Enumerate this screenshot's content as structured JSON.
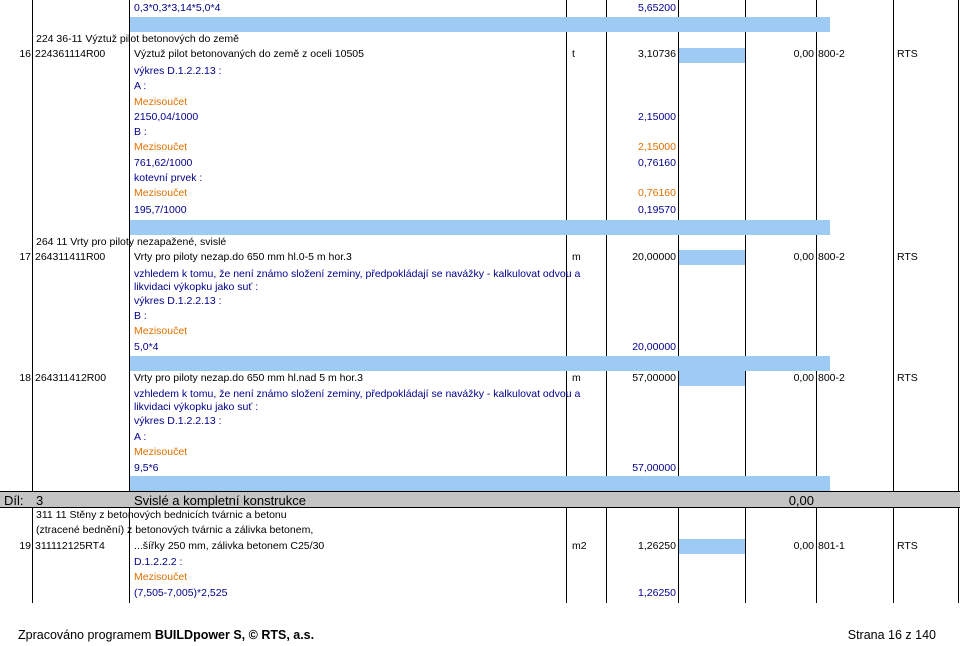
{
  "top_row": {
    "text": "0,3*0,3*3,14*5,0*4",
    "value": "5,65200"
  },
  "group1": {
    "title": "224 36-11 Výztuž pilot betonových do země"
  },
  "item16": {
    "num": "16",
    "code": "224361114R00",
    "desc": "Výztuž pilot betonovaných do země z oceli 10505",
    "unit": "t",
    "qty": "3,10736",
    "price": "0,00",
    "norm": "800-2",
    "src": "RTS",
    "lines": [
      {
        "text": "výkres D.1.2.2.13 :",
        "val": ""
      },
      {
        "text": "A :",
        "val": ""
      },
      {
        "text": "Mezisoučet",
        "val": ""
      },
      {
        "text": "2150,04/1000",
        "val": "2,15000"
      },
      {
        "text": "B :",
        "val": ""
      },
      {
        "text": "Mezisoučet",
        "val": "2,15000"
      },
      {
        "text": "761,62/1000",
        "val": "0,76160"
      },
      {
        "text": "kotevní prvek :",
        "val": ""
      },
      {
        "text": "Mezisoučet",
        "val": "0,76160"
      },
      {
        "text": "195,7/1000",
        "val": "0,19570"
      }
    ]
  },
  "group2": {
    "title": "264 11 Vrty pro piloty nezapažené, svislé"
  },
  "item17": {
    "num": "17",
    "code": "264311411R00",
    "desc": "Vrty pro piloty nezap.do 650 mm hl.0-5 m hor.3",
    "unit": "m",
    "qty": "20,00000",
    "price": "0,00",
    "norm": "800-2",
    "src": "RTS",
    "note1": "vzhledem k tomu, že není známo složení zeminy, předpokládají se navážky - kalkulovat odvou a",
    "note2": "likvidaci výkopku jako suť :",
    "lines": [
      {
        "text": "výkres D.1.2.2.13 :",
        "val": ""
      },
      {
        "text": "B :",
        "val": ""
      },
      {
        "text": "Mezisoučet",
        "val": ""
      },
      {
        "text": "5,0*4",
        "val": "20,00000"
      }
    ]
  },
  "item18": {
    "num": "18",
    "code": "264311412R00",
    "desc": "Vrty pro piloty nezap.do 650 mm hl.nad 5 m hor.3",
    "unit": "m",
    "qty": "57,00000",
    "price": "0,00",
    "norm": "800-2",
    "src": "RTS",
    "note1": "vzhledem k tomu, že není známo složení zeminy, předpokládají se navážky - kalkulovat odvou a",
    "note2": "likvidaci výkopku jako suť :",
    "lines": [
      {
        "text": "výkres D.1.2.2.13 :",
        "val": ""
      },
      {
        "text": "A :",
        "val": ""
      },
      {
        "text": "Mezisoučet",
        "val": ""
      },
      {
        "text": "9,5*6",
        "val": "57,00000"
      }
    ]
  },
  "dil": {
    "label": "Díl:",
    "num": "3",
    "title": "Svislé a kompletní konstrukce",
    "total": "0,00"
  },
  "group3": {
    "title": "311 11 Stěny z betonových bednicích tvárnic a betonu"
  },
  "item19": {
    "pre": "(ztracené bednění) z betonových tvárnic a zálivka betonem,",
    "num": "19",
    "code": "311112125RT4",
    "desc": "...šířky 250 mm, zálivka betonem C25/30",
    "unit": "m2",
    "qty": "1,26250",
    "price": "0,00",
    "norm": "801-1",
    "src": "RTS",
    "lines": [
      {
        "text": "D.1.2.2.2 :",
        "val": ""
      },
      {
        "text": "Mezisoučet",
        "val": ""
      },
      {
        "text": "(7,505-7,005)*2,525",
        "val": "1,26250"
      }
    ]
  },
  "footer": {
    "left_prefix": "Zpracováno programem ",
    "left_bold": "BUILDpower S,  © RTS, a.s.",
    "right": "Strana 16 z 140"
  }
}
